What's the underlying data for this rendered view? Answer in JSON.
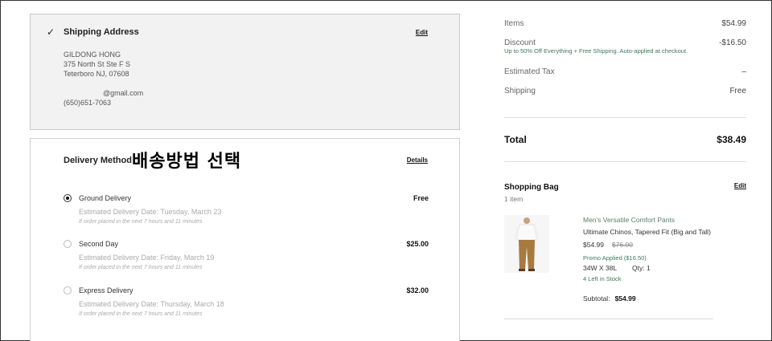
{
  "shipping": {
    "title": "Shipping Address",
    "edit_label": "Edit",
    "name": "GILDONG HONG",
    "street": "375 North St Ste F S",
    "city": "Teterboro NJ, 07608",
    "email": "@gmail.com",
    "phone": "(650)651-7063"
  },
  "delivery": {
    "title": "Delivery Method",
    "annotation": "배송방법 선택",
    "details_label": "Details",
    "options": [
      {
        "name": "Ground Delivery",
        "price": "Free",
        "date": "Estimated Delivery Date: Tuesday, March 23",
        "note": "If order placed in the next 7 hours and 11 minutes",
        "selected": true
      },
      {
        "name": "Second Day",
        "price": "$25.00",
        "date": "Estimated Delivery Date: Friday, March 19",
        "note": "If order placed in the next 7 hours and 11 minutes",
        "selected": false
      },
      {
        "name": "Express Delivery",
        "price": "$32.00",
        "date": "Estimated Delivery Date: Thursday, March 18",
        "note": "If order placed in the next 7 hours and 11 minutes",
        "selected": false
      }
    ]
  },
  "summary": {
    "items_label": "Items",
    "items_value": "$54.99",
    "discount_label": "Discount",
    "discount_value": "-$16.50",
    "discount_note": "Up to 50% Off Everything + Free Shipping. Auto-applied at checkout.",
    "tax_label": "Estimated Tax",
    "tax_value": "–",
    "shipping_label": "Shipping",
    "shipping_value": "Free",
    "total_label": "Total",
    "total_value": "$38.49"
  },
  "bag": {
    "title": "Shopping Bag",
    "edit_label": "Edit",
    "count": "1 item",
    "product": {
      "brand": "Men's Versatile Comfort Pants",
      "name": "Ultimate Chinos, Tapered Fit (Big and Tall)",
      "price": "$54.99",
      "original_price": "$76.00",
      "promo": "Promo Applied ($16.50)",
      "size": "34W X 38L",
      "qty": "Qty: 1",
      "stock": "4 Left in Stock",
      "subtotal_label": "Subtotal:",
      "subtotal_value": "$54.99"
    }
  },
  "colors": {
    "promo_green": "#3b7a57",
    "panel_gray": "#f2f2f2"
  }
}
